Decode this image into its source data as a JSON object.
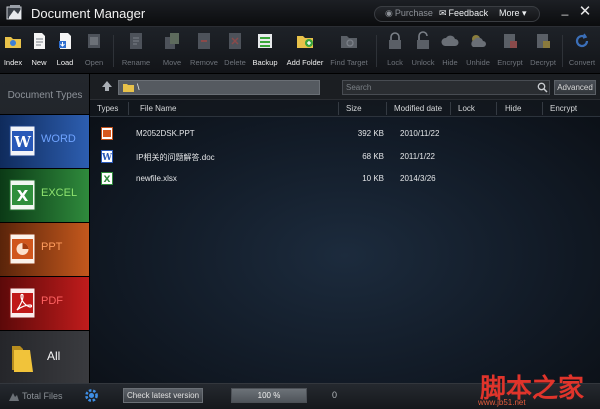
{
  "window": {
    "title": "Document Manager",
    "purchase_label": "Purchase",
    "feedback_label": "Feedback",
    "more_label": "More ▾",
    "minimize_glyph": "_",
    "close_glyph": "✕"
  },
  "toolbar": {
    "items": [
      {
        "label": "Index",
        "icon": "index-folder-icon",
        "enabled": true
      },
      {
        "label": "New",
        "icon": "new-file-icon",
        "enabled": true
      },
      {
        "label": "Load",
        "icon": "load-file-icon",
        "enabled": true
      },
      {
        "label": "Open",
        "icon": "open-icon",
        "enabled": false
      },
      {
        "label": "Rename",
        "icon": "rename-icon",
        "enabled": false
      },
      {
        "label": "Move",
        "icon": "move-icon",
        "enabled": false
      },
      {
        "label": "Remove",
        "icon": "remove-icon",
        "enabled": false
      },
      {
        "label": "Delete",
        "icon": "delete-icon",
        "enabled": false
      },
      {
        "label": "Backup",
        "icon": "backup-icon",
        "enabled": true
      },
      {
        "label": "Add Folder",
        "icon": "add-folder-icon",
        "enabled": true
      },
      {
        "label": "Find Target",
        "icon": "find-target-icon",
        "enabled": false
      },
      {
        "label": "Lock",
        "icon": "lock-icon",
        "enabled": false
      },
      {
        "label": "Unlock",
        "icon": "unlock-icon",
        "enabled": false
      },
      {
        "label": "Hide",
        "icon": "hide-cloud-icon",
        "enabled": false
      },
      {
        "label": "Unhide",
        "icon": "unhide-icon",
        "enabled": false
      },
      {
        "label": "Encrypt",
        "icon": "encrypt-icon",
        "enabled": false
      },
      {
        "label": "Decrypt",
        "icon": "decrypt-icon",
        "enabled": false
      },
      {
        "label": "Convert",
        "icon": "convert-icon",
        "enabled": false
      }
    ]
  },
  "sidebar": {
    "title": "Document Types",
    "categories": [
      {
        "label": "WORD",
        "icon": "word-icon"
      },
      {
        "label": "EXCEL",
        "icon": "excel-icon"
      },
      {
        "label": "PPT",
        "icon": "ppt-icon"
      },
      {
        "label": "PDF",
        "icon": "pdf-icon"
      },
      {
        "label": "All",
        "icon": "folder-icon"
      }
    ]
  },
  "pathbar": {
    "path": "\\",
    "search_placeholder": "Search",
    "advanced_label": "Advanced"
  },
  "filelist": {
    "columns": [
      "Types",
      "File Name",
      "Size",
      "Modified date",
      "Lock",
      "Hide",
      "Encrypt"
    ],
    "rows": [
      {
        "type": "ppt",
        "name": "M2052DSK.PPT",
        "size": "392 KB",
        "date": "2010/11/22"
      },
      {
        "type": "doc",
        "name": "IP相关的问题解答.doc",
        "size": "68 KB",
        "date": "2011/1/22"
      },
      {
        "type": "xlsx",
        "name": "newfile.xlsx",
        "size": "10 KB",
        "date": "2014/3/26"
      }
    ]
  },
  "statusbar": {
    "total_label": "Total Files",
    "check_label": "Check latest version",
    "progress_text": "100 %",
    "progress_value": 100,
    "count": "0"
  },
  "watermark": {
    "text": "脚本之家",
    "url": "www.jb51.net"
  },
  "colors": {
    "word": "#2d5eb0",
    "excel": "#2f8a3c",
    "ppt": "#c4581d",
    "pdf": "#c01c1c"
  }
}
